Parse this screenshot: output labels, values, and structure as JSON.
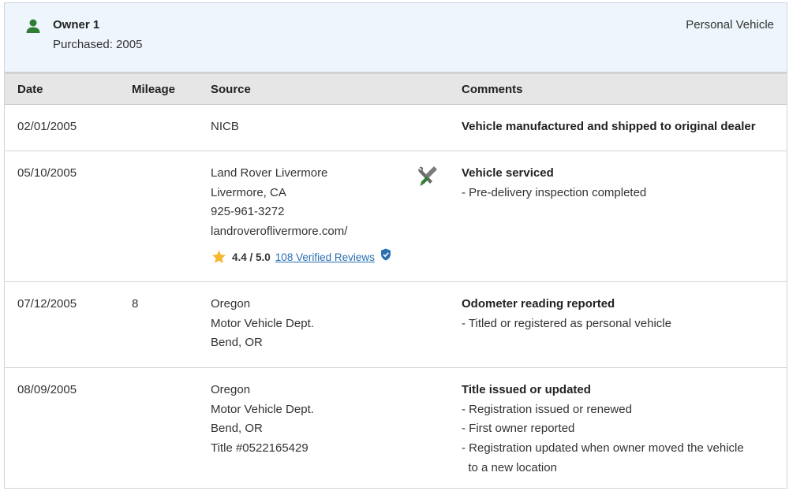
{
  "owner": {
    "name": "Owner 1",
    "purchased": "Purchased: 2005",
    "type": "Personal Vehicle",
    "icon": "person-icon",
    "accent": "#2e7d32"
  },
  "table": {
    "headers": [
      "Date",
      "Mileage",
      "Source",
      "Comments"
    ],
    "rows": [
      {
        "date": "02/01/2005",
        "mileage": "",
        "source": [
          "NICB"
        ],
        "comment_title": "Vehicle manufactured and shipped to original dealer",
        "comment_items": []
      },
      {
        "date": "05/10/2005",
        "mileage": "",
        "source": [
          "Land Rover Livermore",
          "Livermore, CA",
          "925-961-3272",
          "landroveroflivermore.com/"
        ],
        "rating": {
          "score": "4.4 / 5.0",
          "reviews": "108 Verified Reviews"
        },
        "service_icon": "wrench-screwdriver-icon",
        "comment_title": "Vehicle serviced",
        "comment_items": [
          "- Pre-delivery inspection completed"
        ]
      },
      {
        "date": "07/12/2005",
        "mileage": "8",
        "source": [
          "Oregon",
          "Motor Vehicle Dept.",
          "Bend, OR"
        ],
        "comment_title": "Odometer reading reported",
        "comment_items": [
          "- Titled or registered as personal vehicle"
        ]
      },
      {
        "date": "08/09/2005",
        "mileage": "",
        "source": [
          "Oregon",
          "Motor Vehicle Dept.",
          "Bend, OR",
          "Title #0522165429"
        ],
        "comment_title": "Title issued or updated",
        "comment_items": [
          "- Registration issued or renewed",
          "- First owner reported",
          "- Registration updated when owner moved the vehicle",
          "  to a new location"
        ]
      }
    ]
  },
  "colors": {
    "header_bg": "#eef5fc",
    "thead_bg": "#e6e6e6",
    "link": "#2a6fb0",
    "star": "#f5b82e"
  }
}
